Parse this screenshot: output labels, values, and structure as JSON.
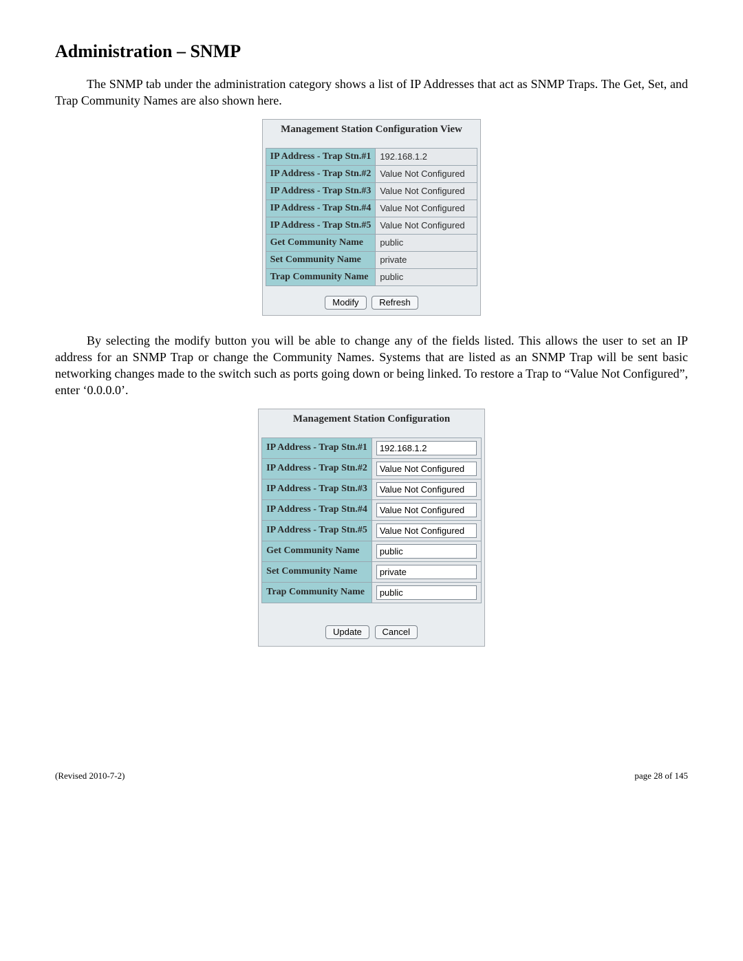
{
  "heading": "Administration – SNMP",
  "para1": "The SNMP tab under the administration category shows a list of IP Addresses that act as SNMP Traps.  The Get, Set, and Trap Community Names are also shown here.",
  "para2": "By selecting the modify button you will be able to change any of the fields listed.  This allows the user to set an IP address for an SNMP Trap or change the Community Names.  Systems that are listed as an SNMP Trap will be sent basic networking changes made to the switch such as ports going down or being linked.  To restore a Trap to “Value Not Configured”, enter ‘0.0.0.0’.",
  "view_panel": {
    "title": "Management Station Configuration View",
    "rows": [
      {
        "label": "IP Address - Trap Stn.#1",
        "value": "192.168.1.2"
      },
      {
        "label": "IP Address - Trap Stn.#2",
        "value": "Value Not Configured"
      },
      {
        "label": "IP Address - Trap Stn.#3",
        "value": "Value Not Configured"
      },
      {
        "label": "IP Address - Trap Stn.#4",
        "value": "Value Not Configured"
      },
      {
        "label": "IP Address - Trap Stn.#5",
        "value": "Value Not Configured"
      },
      {
        "label": "Get Community Name",
        "value": "public"
      },
      {
        "label": "Set Community Name",
        "value": "private"
      },
      {
        "label": "Trap Community Name",
        "value": "public"
      }
    ],
    "buttons": {
      "modify": "Modify",
      "refresh": "Refresh"
    }
  },
  "edit_panel": {
    "title": "Management Station Configuration",
    "rows": [
      {
        "label": "IP Address - Trap Stn.#1",
        "value": "192.168.1.2"
      },
      {
        "label": "IP Address - Trap Stn.#2",
        "value": "Value Not Configured"
      },
      {
        "label": "IP Address - Trap Stn.#3",
        "value": "Value Not Configured"
      },
      {
        "label": "IP Address - Trap Stn.#4",
        "value": "Value Not Configured"
      },
      {
        "label": "IP Address - Trap Stn.#5",
        "value": "Value Not Configured"
      },
      {
        "label": "Get Community Name",
        "value": "public"
      },
      {
        "label": "Set Community Name",
        "value": "private"
      },
      {
        "label": "Trap Community Name",
        "value": "public"
      }
    ],
    "buttons": {
      "update": "Update",
      "cancel": "Cancel"
    }
  },
  "footer": {
    "left": "(Revised 2010-7-2)",
    "right": "page 28 of 145"
  }
}
